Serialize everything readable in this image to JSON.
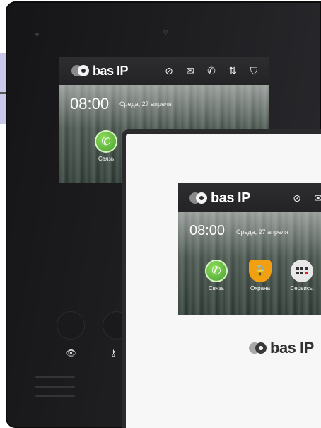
{
  "brand": {
    "name": "bas IP"
  },
  "screen": {
    "time": "08:00",
    "date": "Среда, 27 апреля",
    "status_icons": [
      "do-not-disturb-icon",
      "envelope-icon",
      "phone-call-icon",
      "transfer-icon",
      "shield-icon"
    ],
    "apps": [
      {
        "label": "Связь",
        "icon": "phone-icon",
        "color": "#4caf50"
      },
      {
        "label": "Охрана",
        "icon": "lock-shield-icon",
        "color": "#f2a012"
      },
      {
        "label": "Сервисы",
        "icon": "grid-icon",
        "color": "#e8e8e8"
      }
    ]
  }
}
